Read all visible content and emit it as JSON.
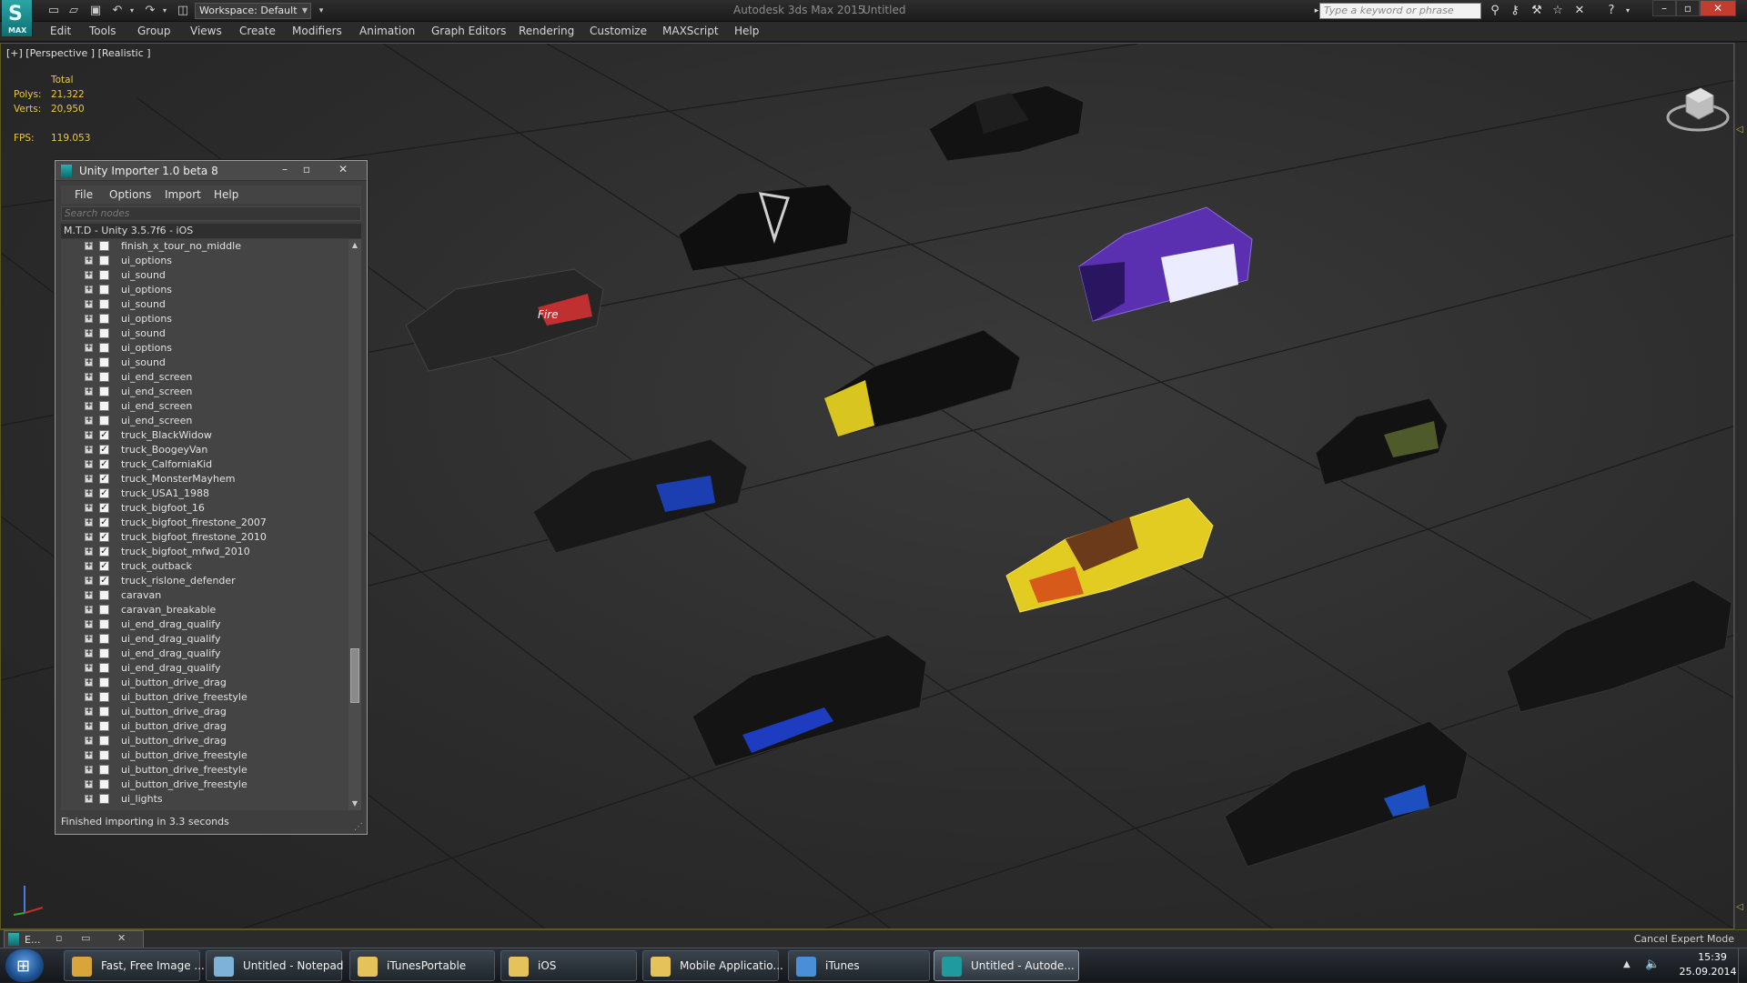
{
  "app": {
    "logo_text": "MAX",
    "title": "Autodesk 3ds Max  2015",
    "document": "Untitled",
    "workspace": "Workspace: Default",
    "search_placeholder": "Type a keyword or phrase"
  },
  "menu": [
    "Edit",
    "Tools",
    "Group",
    "Views",
    "Create",
    "Modifiers",
    "Animation",
    "Graph Editors",
    "Rendering",
    "Customize",
    "MAXScript",
    "Help"
  ],
  "viewport": {
    "label": "[+] [Perspective ] [Realistic ]",
    "stats": {
      "total_label": "Total",
      "polys_label": "Polys:",
      "polys_value": "21,322",
      "verts_label": "Verts:",
      "verts_value": "20,950",
      "fps_label": "FPS:",
      "fps_value": "119.053"
    }
  },
  "importer": {
    "title": "Unity Importer 1.0 beta 8",
    "menu": [
      "File",
      "Options",
      "Import",
      "Help"
    ],
    "search_placeholder": "Search nodes",
    "root": "M.T.D - Unity 3.5.7f6 - iOS",
    "nodes": [
      {
        "label": "finish_x_tour_no_middle",
        "checked": false
      },
      {
        "label": "ui_options",
        "checked": false
      },
      {
        "label": "ui_sound",
        "checked": false
      },
      {
        "label": "ui_options",
        "checked": false
      },
      {
        "label": "ui_sound",
        "checked": false
      },
      {
        "label": "ui_options",
        "checked": false
      },
      {
        "label": "ui_sound",
        "checked": false
      },
      {
        "label": "ui_options",
        "checked": false
      },
      {
        "label": "ui_sound",
        "checked": false
      },
      {
        "label": "ui_end_screen",
        "checked": false
      },
      {
        "label": "ui_end_screen",
        "checked": false
      },
      {
        "label": "ui_end_screen",
        "checked": false
      },
      {
        "label": "ui_end_screen",
        "checked": false
      },
      {
        "label": "truck_BlackWidow",
        "checked": true
      },
      {
        "label": "truck_BoogeyVan",
        "checked": true
      },
      {
        "label": "truck_CalforniaKid",
        "checked": true
      },
      {
        "label": "truck_MonsterMayhem",
        "checked": true
      },
      {
        "label": "truck_USA1_1988",
        "checked": true
      },
      {
        "label": "truck_bigfoot_16",
        "checked": true
      },
      {
        "label": "truck_bigfoot_firestone_2007",
        "checked": true
      },
      {
        "label": "truck_bigfoot_firestone_2010",
        "checked": true
      },
      {
        "label": "truck_bigfoot_mfwd_2010",
        "checked": true
      },
      {
        "label": "truck_outback",
        "checked": true
      },
      {
        "label": "truck_rislone_defender",
        "checked": true
      },
      {
        "label": "caravan",
        "checked": false
      },
      {
        "label": "caravan_breakable",
        "checked": false
      },
      {
        "label": "ui_end_drag_qualify",
        "checked": false
      },
      {
        "label": "ui_end_drag_qualify",
        "checked": false
      },
      {
        "label": "ui_end_drag_qualify",
        "checked": false
      },
      {
        "label": "ui_end_drag_qualify",
        "checked": false
      },
      {
        "label": "ui_button_drive_drag",
        "checked": false
      },
      {
        "label": "ui_button_drive_freestyle",
        "checked": false
      },
      {
        "label": "ui_button_drive_drag",
        "checked": false
      },
      {
        "label": "ui_button_drive_drag",
        "checked": false
      },
      {
        "label": "ui_button_drive_drag",
        "checked": false
      },
      {
        "label": "ui_button_drive_freestyle",
        "checked": false
      },
      {
        "label": "ui_button_drive_freestyle",
        "checked": false
      },
      {
        "label": "ui_button_drive_freestyle",
        "checked": false
      },
      {
        "label": "ui_lights",
        "checked": false
      }
    ],
    "status": "Finished importing in 3.3 seconds"
  },
  "statusbar": {
    "mini_label": "E...",
    "cancel_expert": "Cancel Expert Mode"
  },
  "taskbar": {
    "items": [
      {
        "label": "Fast, Free Image ...",
        "icon": "chrome-icon",
        "color": "#d9a43a"
      },
      {
        "label": "Untitled - Notepad",
        "icon": "notepad-icon",
        "color": "#7fb2d9"
      },
      {
        "label": "iTunesPortable",
        "icon": "folder-icon",
        "color": "#e6c25a"
      },
      {
        "label": "iOS",
        "icon": "folder-icon",
        "color": "#e6c25a"
      },
      {
        "label": "Mobile Applicatio...",
        "icon": "folder-icon",
        "color": "#e6c25a"
      },
      {
        "label": "iTunes",
        "icon": "itunes-icon",
        "color": "#4a8ed8"
      },
      {
        "label": "Untitled - Autode...",
        "icon": "3dsmax-icon",
        "color": "#1f9a9e"
      }
    ],
    "time": "15:39",
    "date": "25.09.2014"
  }
}
